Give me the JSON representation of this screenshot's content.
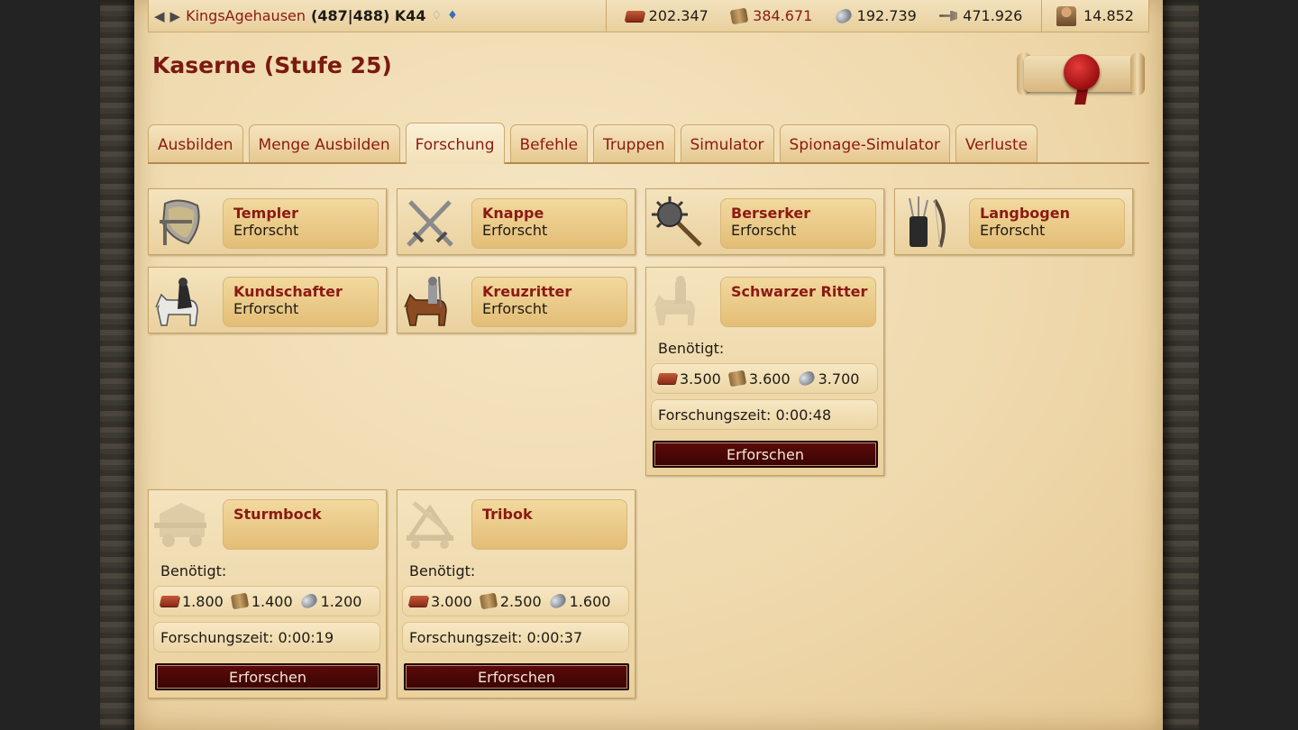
{
  "topbar": {
    "village_name": "KingsAgehausen",
    "coords": "(487|488) K44",
    "resources": {
      "brick": "202.347",
      "wood": "384.671",
      "ore": "192.739",
      "tools": "471.926"
    },
    "population": "14.852"
  },
  "page_title": "Kaserne (Stufe 25)",
  "tabs": [
    {
      "label": "Ausbilden"
    },
    {
      "label": "Menge Ausbilden"
    },
    {
      "label": "Forschung"
    },
    {
      "label": "Befehle"
    },
    {
      "label": "Truppen"
    },
    {
      "label": "Simulator"
    },
    {
      "label": "Spionage-Simulator"
    },
    {
      "label": "Verluste"
    }
  ],
  "active_tab": "Forschung",
  "units": {
    "templer": {
      "name": "Templer",
      "status": "Erforscht"
    },
    "knappe": {
      "name": "Knappe",
      "status": "Erforscht"
    },
    "berserker": {
      "name": "Berserker",
      "status": "Erforscht"
    },
    "langbogen": {
      "name": "Langbogen",
      "status": "Erforscht"
    },
    "kundschafter": {
      "name": "Kundschafter",
      "status": "Erforscht"
    },
    "kreuzritter": {
      "name": "Kreuzritter",
      "status": "Erforscht"
    },
    "schwarzer_ritter": {
      "name": "Schwarzer Ritter",
      "required_label": "Benötigt:",
      "cost": {
        "brick": "3.500",
        "wood": "3.600",
        "ore": "3.700"
      },
      "time": "Forschungszeit: 0:00:48",
      "button": "Erforschen"
    },
    "sturmbock": {
      "name": "Sturmbock",
      "required_label": "Benötigt:",
      "cost": {
        "brick": "1.800",
        "wood": "1.400",
        "ore": "1.200"
      },
      "time": "Forschungszeit: 0:00:19",
      "button": "Erforschen"
    },
    "tribok": {
      "name": "Tribok",
      "required_label": "Benötigt:",
      "cost": {
        "brick": "3.000",
        "wood": "2.500",
        "ore": "1.600"
      },
      "time": "Forschungszeit: 0:00:37",
      "button": "Erforschen"
    }
  },
  "colors": {
    "accent_red": "#8b1a12",
    "parchment": "#efd9ad",
    "button_dark_red": "#4a0606"
  }
}
